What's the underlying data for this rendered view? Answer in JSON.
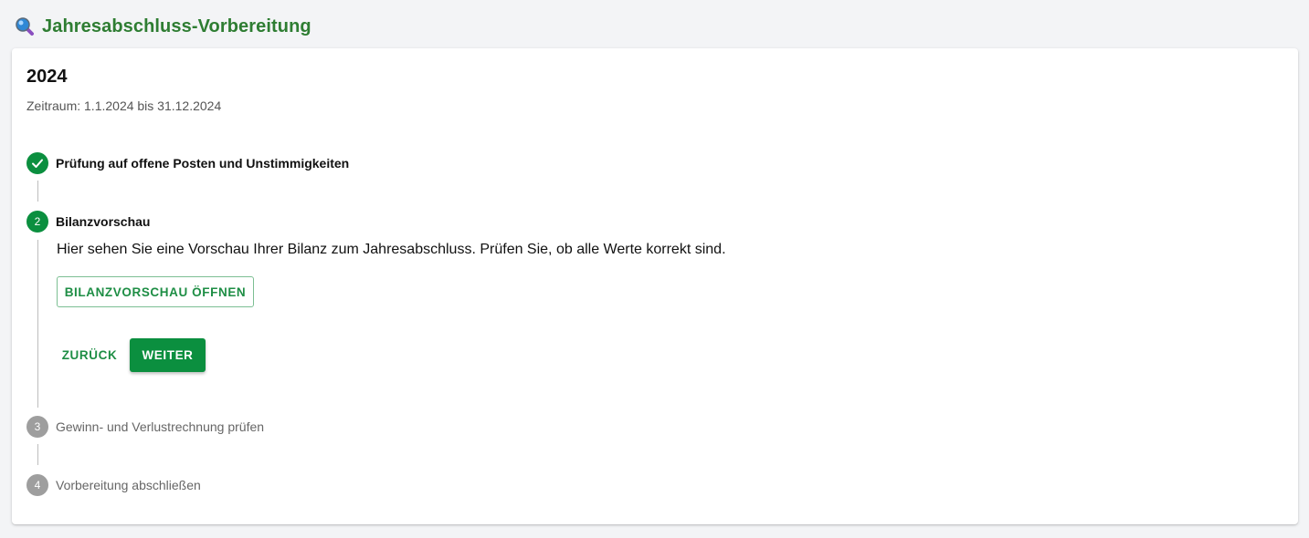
{
  "header": {
    "title": "Jahresabschluss-Vorbereitung",
    "icon": "magnifier-icon"
  },
  "card": {
    "year": "2024",
    "period": "Zeitraum: 1.1.2024 bis 31.12.2024"
  },
  "steps": [
    {
      "number": "",
      "label": "Prüfung auf offene Posten und Unstimmigkeiten",
      "status": "completed"
    },
    {
      "number": "2",
      "label": "Bilanzvorschau",
      "status": "active",
      "description": "Hier sehen Sie eine Vorschau Ihrer Bilanz zum Jahresabschluss. Prüfen Sie, ob alle Werte korrekt sind.",
      "open_button": "BILANZVORSCHAU ÖFFNEN",
      "back_button": "ZURÜCK",
      "next_button": "WEITER"
    },
    {
      "number": "3",
      "label": "Gewinn- und Verlustrechnung prüfen",
      "status": "pending"
    },
    {
      "number": "4",
      "label": "Vorbereitung abschließen",
      "status": "pending"
    }
  ],
  "colors": {
    "accent": "#0b8f3f",
    "title": "#2e7d32",
    "pending": "#9e9e9e"
  }
}
